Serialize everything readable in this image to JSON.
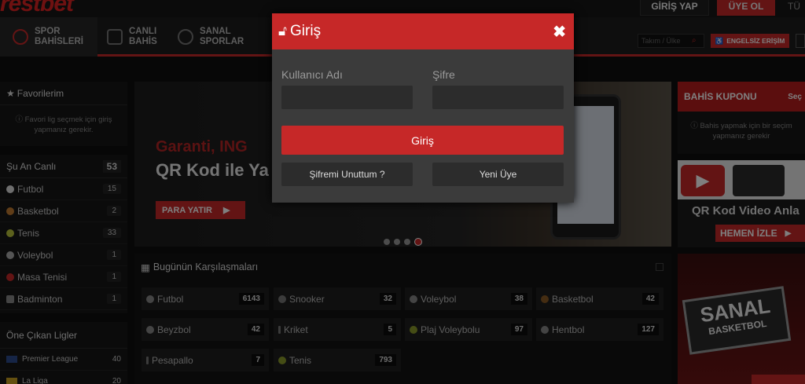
{
  "header": {
    "logo_text": "restbet",
    "login_label": "GİRİŞ YAP",
    "register_label": "ÜYE OL",
    "language_label": "TÜ"
  },
  "nav": {
    "items": [
      {
        "label": "SPOR BAHİSLERİ",
        "icon": "soccer-ball-icon"
      },
      {
        "label": "CANLI BAHİS",
        "icon": "tv-icon"
      },
      {
        "label": "SANAL SPORLAR",
        "icon": "user-icon"
      }
    ],
    "search_placeholder": "Takım / Ülke",
    "accessible_label": "ENGELSİZ ERİŞİM"
  },
  "sidebar": {
    "favorites_title": "Favorilerim",
    "favorites_note": "Favori lig seçmek için giriş yapmanız gerekir.",
    "live_title": "Şu An Canlı",
    "live_count": "53",
    "live_sports": [
      {
        "name": "Futbol",
        "count": "15"
      },
      {
        "name": "Basketbol",
        "count": "2"
      },
      {
        "name": "Tenis",
        "count": "33"
      },
      {
        "name": "Voleybol",
        "count": "1"
      },
      {
        "name": "Masa Tenisi",
        "count": "1"
      },
      {
        "name": "Badminton",
        "count": "1"
      }
    ],
    "leagues_title": "Öne Çıkan Ligler",
    "leagues": [
      {
        "name": "Premier League",
        "count": "40"
      },
      {
        "name": "La Liga",
        "count": "20"
      }
    ]
  },
  "banner": {
    "line1": "Garanti, ING",
    "line2": "QR Kod ile Ya",
    "cta": "PARA YATIR"
  },
  "today": {
    "title": "Bugünün Karşılaşmaları",
    "sports": [
      {
        "name": "Futbol",
        "count": "6143"
      },
      {
        "name": "Snooker",
        "count": "32"
      },
      {
        "name": "Voleybol",
        "count": "38"
      },
      {
        "name": "Basketbol",
        "count": "42"
      },
      {
        "name": "Beyzbol",
        "count": "42"
      },
      {
        "name": "Kriket",
        "count": "5"
      },
      {
        "name": "Plaj Voleybolu",
        "count": "97"
      },
      {
        "name": "Hentbol",
        "count": "127"
      },
      {
        "name": "Pesapallo",
        "count": "7"
      },
      {
        "name": "Tenis",
        "count": "793"
      }
    ]
  },
  "coupon": {
    "title": "BAHİS KUPONU",
    "tab": "Seç",
    "note": "Bahis yapmak için bir seçim yapmanız gerekir"
  },
  "promo": {
    "title": "QR Kod Video Anla",
    "cta": "HEMEN İZLE",
    "sanal_line1": "SANAL",
    "sanal_line2": "BASKETBOL"
  },
  "modal": {
    "title": "Giriş",
    "username_label": "Kullanıcı Adı",
    "password_label": "Şifre",
    "submit_label": "Giriş",
    "forgot_label": "Şifremi Unuttum ?",
    "new_member_label": "Yeni Üye"
  }
}
